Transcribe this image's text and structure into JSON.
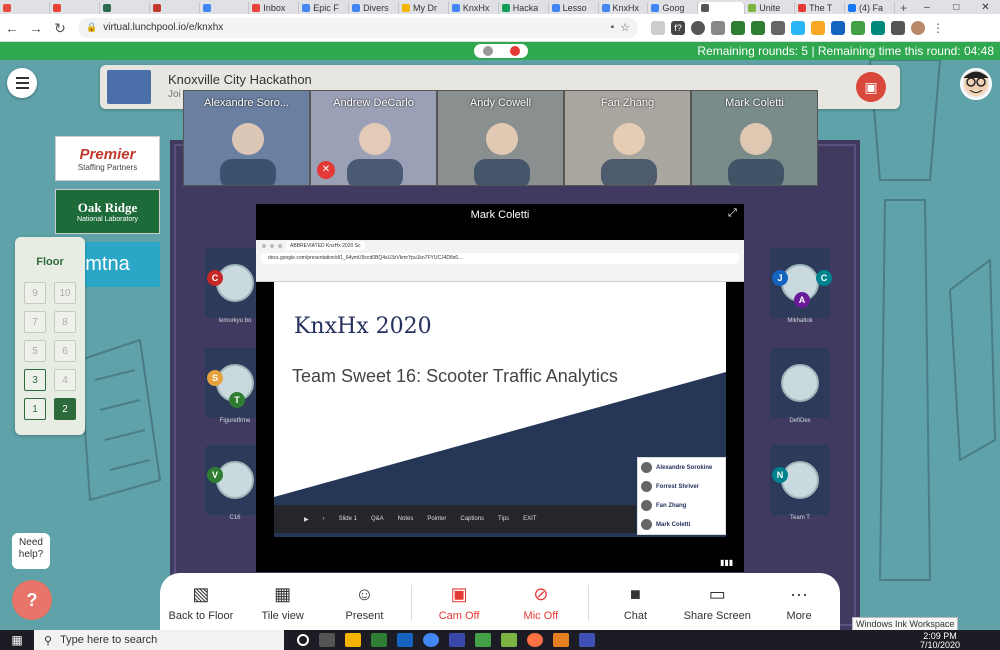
{
  "browser": {
    "tabs": [
      {
        "label": "",
        "color": "#e74c3c"
      },
      {
        "label": "",
        "color": "#ea4335"
      },
      {
        "label": "",
        "color": "#2d6a4f"
      },
      {
        "label": "",
        "color": "#c0392b"
      },
      {
        "label": "",
        "color": "#4285f4"
      },
      {
        "label": "Inbox",
        "color": "#ea4335"
      },
      {
        "label": "Epic F",
        "color": "#4285f4"
      },
      {
        "label": "Divers",
        "color": "#4285f4"
      },
      {
        "label": "My Dr",
        "color": "#f4b400"
      },
      {
        "label": "KnxHx",
        "color": "#4285f4"
      },
      {
        "label": "Hacka",
        "color": "#0f9d58"
      },
      {
        "label": "Lesso",
        "color": "#4285f4"
      },
      {
        "label": "KnxHx",
        "color": "#4285f4"
      },
      {
        "label": "Goog",
        "color": "#4285f4"
      },
      {
        "label": "",
        "color": "#555555",
        "active": true
      },
      {
        "label": "Unite",
        "color": "#7cb342"
      },
      {
        "label": "The T",
        "color": "#e53935"
      },
      {
        "label": "(4) Fa",
        "color": "#1877f2"
      }
    ],
    "new_tab": "+",
    "url": "virtual.lunchpool.io/e/knxhx"
  },
  "session": {
    "status": "Remaining rounds: 5 | Remaining time this round: 04:48"
  },
  "event": {
    "title": "Knoxville City Hackathon",
    "subtitle": "Joi"
  },
  "sponsors": [
    {
      "name": "Premier",
      "sub": "Staffing Partners",
      "color": "#c0392b"
    },
    {
      "name": "Oak Ridge",
      "sub": "National Laboratory",
      "color": "#1e6b3a"
    },
    {
      "name": "mtna",
      "sub": "",
      "color": "#2aa6c6"
    }
  ],
  "floor": {
    "title": "Floor",
    "levels": [
      "9",
      "10",
      "7",
      "8",
      "5",
      "6",
      "3",
      "4",
      "1",
      "2"
    ],
    "available": [
      "3",
      "1",
      "2"
    ],
    "current": "2"
  },
  "participants": [
    {
      "name": "Alexandre Soro...",
      "bg": "#6b7fa0",
      "muted": false
    },
    {
      "name": "Andrew DeCarlo",
      "bg": "#9aa0b5",
      "muted": true
    },
    {
      "name": "Andy Cowell",
      "bg": "#8a8f90",
      "muted": false
    },
    {
      "name": "Fan Zhang",
      "bg": "#a9a6a0",
      "muted": false
    },
    {
      "name": "Mark Coletti",
      "bg": "#7a8c8a",
      "muted": false
    }
  ],
  "spotlight": {
    "name": "Mark Coletti",
    "slide_title": "KnxHx 2020",
    "slide_subtitle": "Team Sweet 16: Scooter Traffic Analytics",
    "inner_tab": "ABBREVIATED KnxHx 2020 Sc",
    "inner_url": "docs.google.com/presentation/d/1_64ymU9ccd0BQ4sU3zVkmrYpu1kn7FYUCJ4D8x6...",
    "slide_label": "Slide 1",
    "slide_controls": [
      "Q&A",
      "Notes",
      "Pointer",
      "Captions",
      "Tips",
      "EXIT"
    ],
    "attendees": [
      "Alexandre Sorokine",
      "Forrest Shriver",
      "Fan Zhang",
      "Mark Coletti"
    ]
  },
  "toolbar": {
    "items": [
      {
        "label": "Back to Floor",
        "icon": "map-icon"
      },
      {
        "label": "Tile view",
        "icon": "grid-icon"
      },
      {
        "label": "Present",
        "icon": "present-icon"
      },
      {
        "label": "Cam Off",
        "icon": "camera-off-icon",
        "red": true
      },
      {
        "label": "Mic Off",
        "icon": "mic-off-icon",
        "red": true
      },
      {
        "label": "Chat",
        "icon": "chat-icon"
      },
      {
        "label": "Share Screen",
        "icon": "share-screen-icon"
      },
      {
        "label": "More",
        "icon": "more-icon"
      }
    ]
  },
  "help": {
    "label": "Need help?"
  },
  "taskbar": {
    "search_placeholder": "Type here to search",
    "time": "2:09 PM",
    "date": "7/10/2020",
    "ink_tooltip": "Windows Ink Workspace"
  },
  "tables": [
    {
      "seats": [
        "C"
      ],
      "label": "lemurkyu bo"
    },
    {
      "seats": [
        "S",
        "T"
      ],
      "label": "Figuretfrme"
    },
    {
      "seats": [
        "V"
      ],
      "label": "C16"
    },
    {
      "seats": [
        "J",
        "A",
        "C"
      ],
      "label": "Mikhatlok"
    },
    {
      "seats": [],
      "label": "DefiDex"
    },
    {
      "seats": [
        "N"
      ],
      "label": "Team T"
    }
  ]
}
